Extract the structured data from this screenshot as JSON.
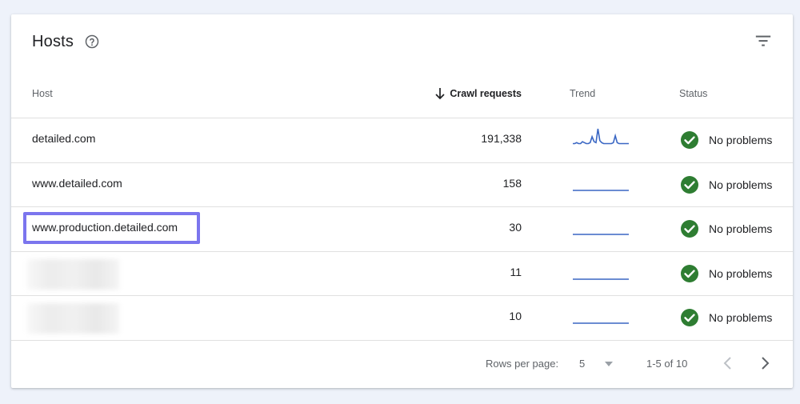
{
  "card": {
    "title": "Hosts",
    "help_icon": "help-circle-icon",
    "filter_icon": "filter-icon"
  },
  "columns": {
    "host": "Host",
    "crawl_requests": "Crawl requests",
    "trend": "Trend",
    "status": "Status"
  },
  "sort": {
    "column": "crawl_requests",
    "direction": "descending",
    "icon": "arrow-down-icon"
  },
  "rows": [
    {
      "host": "detailed.com",
      "crawl_requests": "191,338",
      "status": "No problems",
      "trend": [
        2,
        2,
        3,
        2,
        2,
        4,
        3,
        2,
        2,
        3,
        9,
        4,
        3,
        17,
        5,
        3,
        2,
        2,
        2,
        2,
        2,
        3,
        10,
        3,
        2,
        2,
        2,
        2,
        2,
        2
      ],
      "blurred": false
    },
    {
      "host": "www.detailed.com",
      "crawl_requests": "158",
      "status": "No problems",
      "trend": [
        1,
        1,
        1,
        1,
        1,
        1,
        1,
        1,
        1,
        1
      ],
      "blurred": false
    },
    {
      "host": "www.production.detailed.com",
      "crawl_requests": "30",
      "status": "No problems",
      "trend": [
        1,
        1,
        1,
        1,
        1,
        1,
        1,
        1,
        1,
        1
      ],
      "blurred": false,
      "highlighted": true
    },
    {
      "host": "",
      "crawl_requests": "11",
      "status": "No problems",
      "trend": [
        1,
        1,
        1,
        1,
        1,
        1,
        1,
        1,
        1,
        1
      ],
      "blurred": true
    },
    {
      "host": "",
      "crawl_requests": "10",
      "status": "No problems",
      "trend": [
        1,
        1,
        1,
        1,
        1,
        1,
        1,
        1,
        1,
        1
      ],
      "blurred": true
    }
  ],
  "pagination": {
    "rows_per_page_label": "Rows per page:",
    "rows_per_page_value": "5",
    "range": "1-5 of 10"
  },
  "colors": {
    "trend_line": "#3a67c4",
    "status_ok": "#2e7d32",
    "highlight_border": "#7b75ee",
    "page_bg": "#eef2fa"
  }
}
